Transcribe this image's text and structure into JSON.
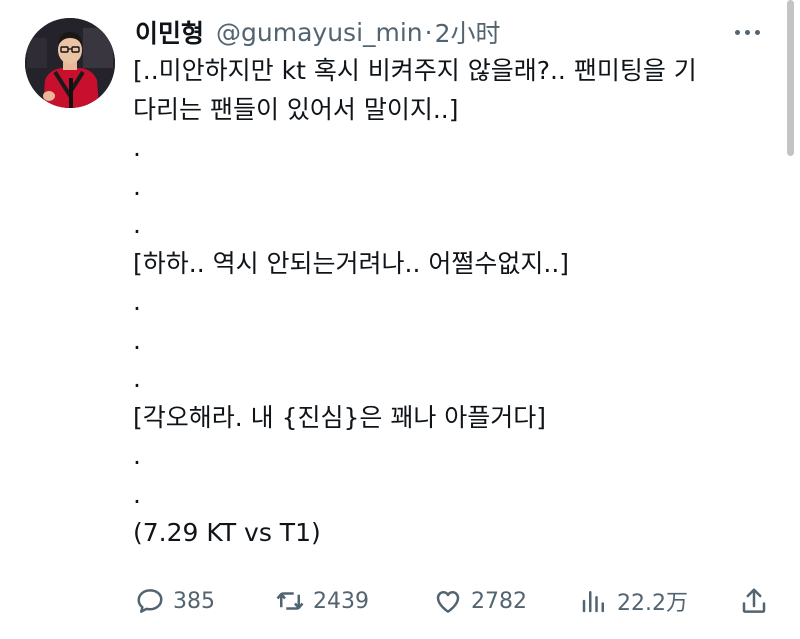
{
  "tweet": {
    "author_name": "이민형",
    "author_handle": "@gumayusi_min",
    "separator": "·",
    "time": "2小时",
    "lines": [
      "[..미안하지만 kt 혹시 비켜주지 않을래?.. 팬미팅을 기",
      "다리는 팬들이 있어서 말이지..]",
      ".",
      ".",
      ".",
      "[하하.. 역시 안되는거려나.. 어쩔수없지..]",
      ".",
      ".",
      ".",
      "[각오해라. 내 {진심}은 꽤나 아플거다]",
      ".",
      ".",
      "(7.29 KT vs T1)"
    ]
  },
  "actions": {
    "reply_icon": "speech-bubble-icon",
    "reply_count": "385",
    "retweet_icon": "retweet-arrows-icon",
    "retweet_count": "2439",
    "like_icon": "heart-icon",
    "like_count": "2782",
    "views_icon": "bar-chart-icon",
    "views_count": "22.2万",
    "share_icon": "share-upload-icon"
  },
  "colors": {
    "text": "#0f1419",
    "secondary": "#536471",
    "background": "#ffffff"
  }
}
